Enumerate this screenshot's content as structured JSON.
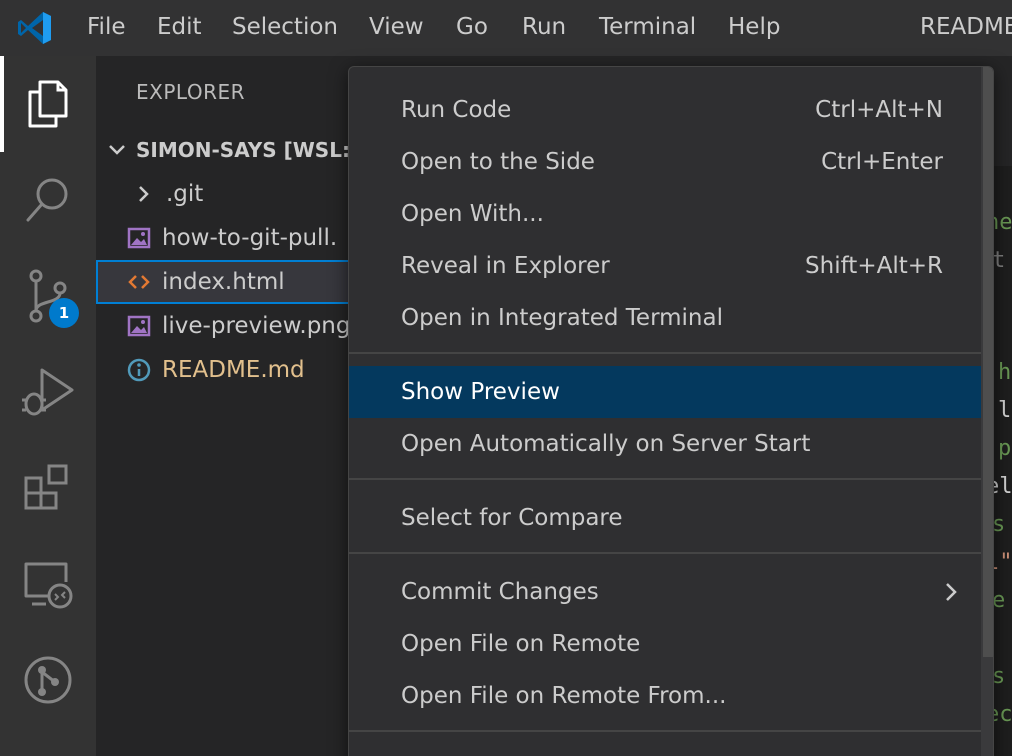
{
  "menubar": {
    "items": [
      "File",
      "Edit",
      "Selection",
      "View",
      "Go",
      "Run",
      "Terminal",
      "Help"
    ],
    "window_title": "README"
  },
  "activity_bar": {
    "icons": [
      "files-icon",
      "search-icon",
      "source-control-icon",
      "run-debug-icon",
      "extensions-icon",
      "remote-explorer-icon",
      "git-graph-icon"
    ],
    "source_control_badge": "1"
  },
  "sidebar": {
    "header": "EXPLORER",
    "root_folder": "SIMON-SAYS [WSL: U",
    "items": [
      {
        "label": ".git",
        "type": "folder"
      },
      {
        "label": "how-to-git-pull.",
        "type": "image"
      },
      {
        "label": "index.html",
        "type": "html"
      },
      {
        "label": "live-preview.png",
        "type": "image"
      },
      {
        "label": "README.md",
        "type": "info"
      }
    ]
  },
  "editor": {
    "fragments": [
      "ne",
      "t",
      "h",
      "l",
      "p",
      "el",
      "s",
      "l\"",
      "e",
      "s",
      "ec"
    ]
  },
  "context_menu": {
    "items": [
      {
        "label": "Run Code",
        "shortcut": "Ctrl+Alt+N"
      },
      {
        "label": "Open to the Side",
        "shortcut": "Ctrl+Enter"
      },
      {
        "label": "Open With...",
        "shortcut": ""
      },
      {
        "label": "Reveal in Explorer",
        "shortcut": "Shift+Alt+R"
      },
      {
        "label": "Open in Integrated Terminal",
        "shortcut": ""
      },
      {
        "label": "Show Preview",
        "shortcut": "",
        "highlighted": true
      },
      {
        "label": "Open Automatically on Server Start",
        "shortcut": ""
      },
      {
        "label": "Select for Compare",
        "shortcut": ""
      },
      {
        "label": "Commit Changes",
        "shortcut": "",
        "submenu": true
      },
      {
        "label": "Open File on Remote",
        "shortcut": ""
      },
      {
        "label": "Open File on Remote From...",
        "shortcut": ""
      }
    ]
  },
  "colors": {
    "accent": "#007acc",
    "menu_highlight": "#04395e",
    "readme_text": "#e2c08d",
    "html_icon": "#e37933",
    "image_icon": "#a074c4",
    "info_icon": "#519aba"
  }
}
